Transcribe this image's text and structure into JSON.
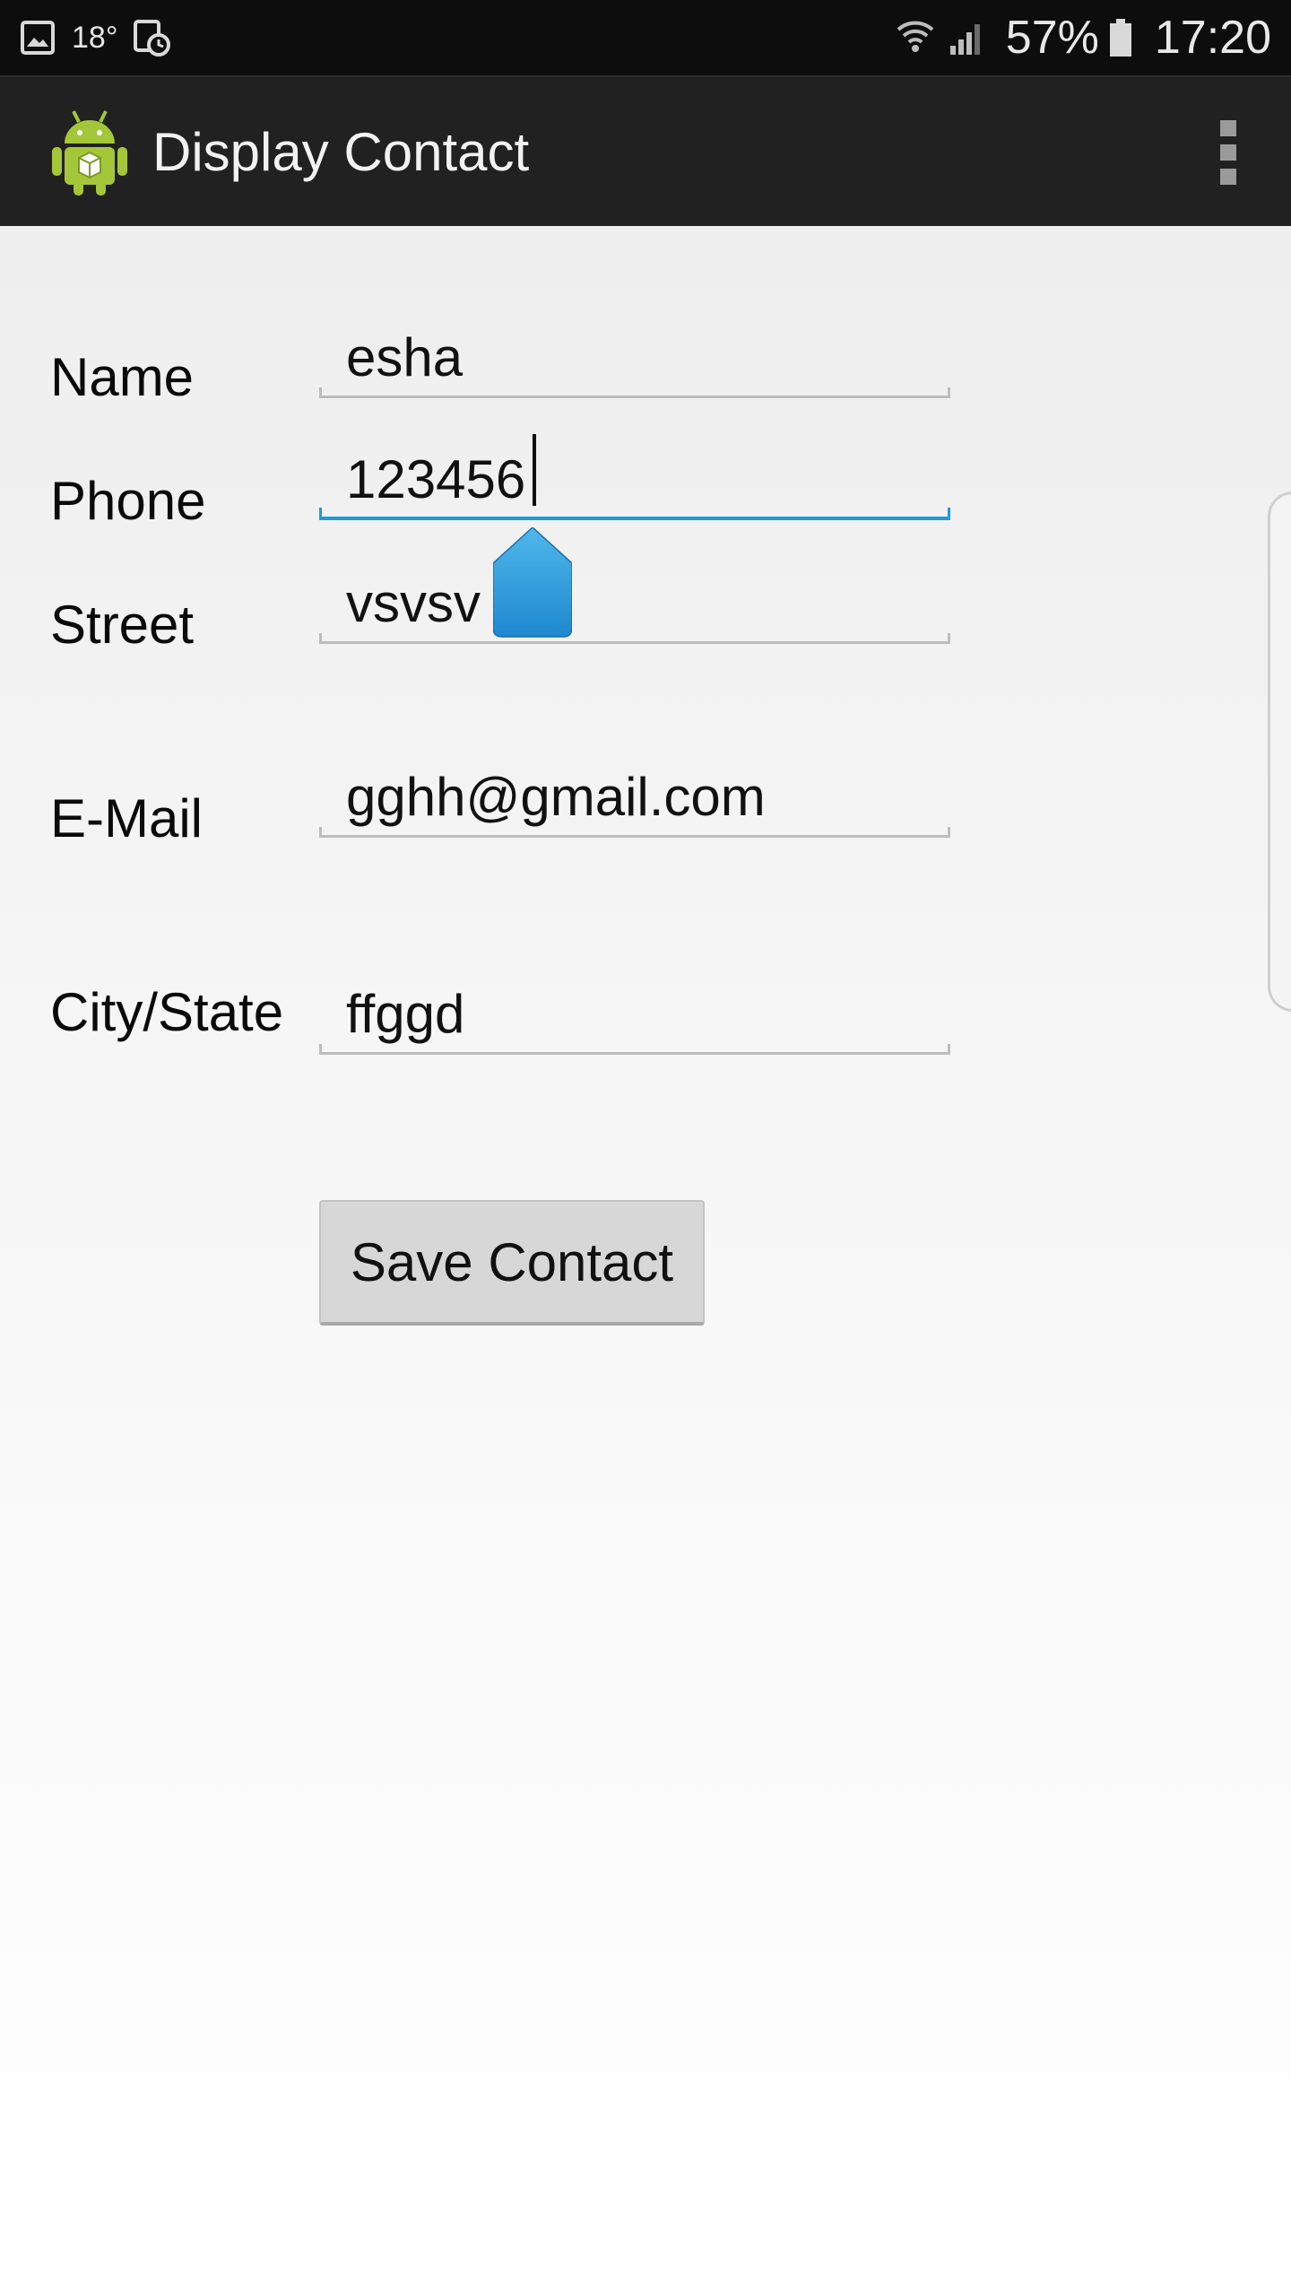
{
  "status_bar": {
    "temperature": "18°",
    "battery_percent": "57%",
    "time": "17:20",
    "icons": [
      "gallery-icon",
      "clock-icon",
      "wifi-icon",
      "signal-icon",
      "battery-icon"
    ]
  },
  "action_bar": {
    "title": "Display Contact",
    "logo_icon": "android-icon",
    "overflow_icon": "overflow-menu-icon"
  },
  "form": {
    "name": {
      "label": "Name",
      "value": "esha"
    },
    "phone": {
      "label": "Phone",
      "value": "123456"
    },
    "street": {
      "label": "Street",
      "value": "vsvsv"
    },
    "email": {
      "label": "E-Mail",
      "value": "gghh@gmail.com"
    },
    "city": {
      "label": "City/State",
      "value": "ffggd"
    }
  },
  "save_button": {
    "label": "Save Contact"
  },
  "colors": {
    "focus_accent": "#1e9bd7",
    "action_bar": "#212121",
    "status_bar": "#0d0d0d"
  }
}
